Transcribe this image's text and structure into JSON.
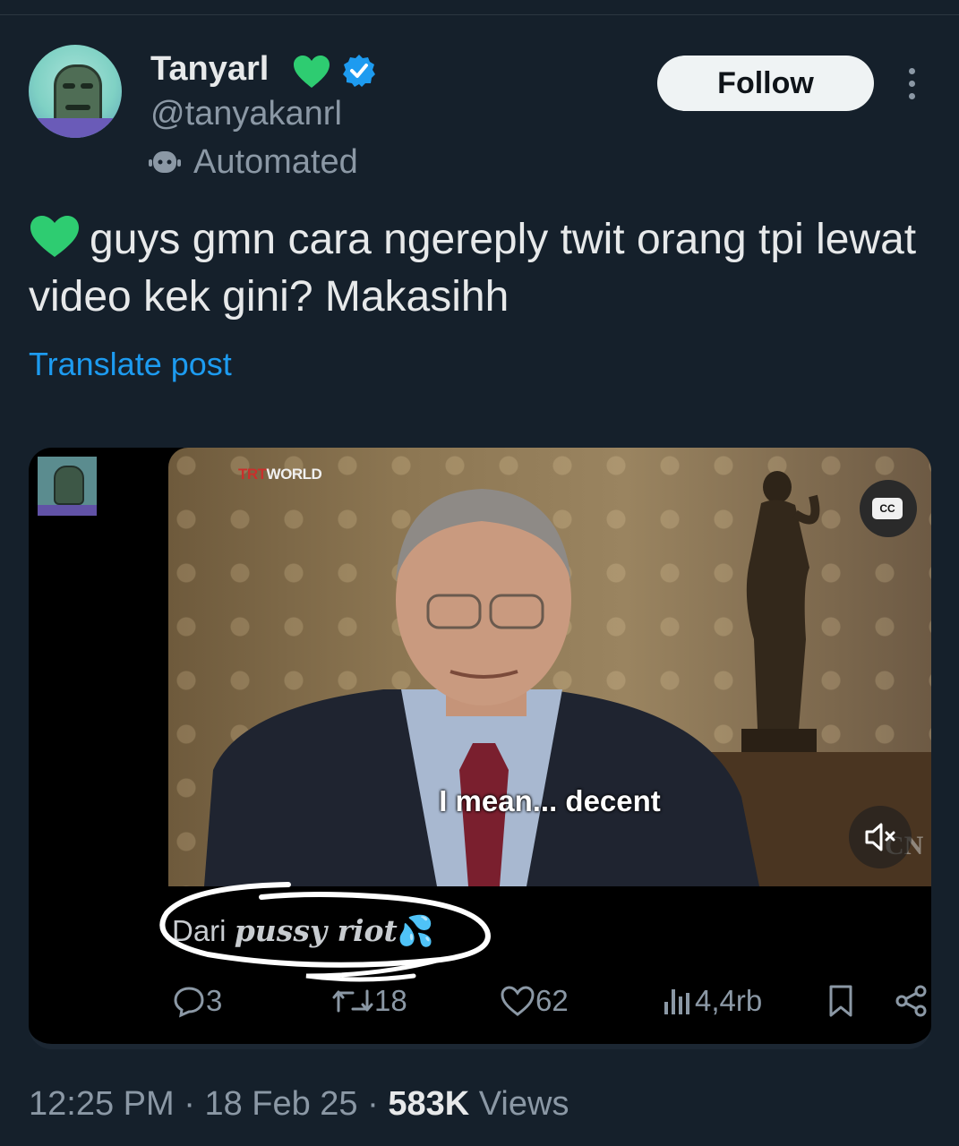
{
  "author": {
    "name": "Tanyarl",
    "handle": "@tanyakanrl",
    "label": "Automated"
  },
  "follow_label": "Follow",
  "post": {
    "text": "guys gmn cara ngereply twit orang tpi lewat video kek gini? Makasihh",
    "translate_label": "Translate post"
  },
  "media": {
    "channel_logo": "TRTWORLD",
    "channel_logo_red": "TRT",
    "channel_logo_white": "WORLD",
    "subtitle": "I mean... decent",
    "cc_label": "CC",
    "watermark": "CN",
    "caption_plain": "Dari",
    "caption_styled": "pussy riot",
    "caption_emoji": "💦"
  },
  "stats": {
    "replies": "3",
    "reposts": "18",
    "likes": "62",
    "views": "4,4rb"
  },
  "meta": {
    "time": "12:25 PM",
    "separator": "·",
    "date": "18 Feb 25",
    "views_count": "583K",
    "views_label": "Views"
  },
  "colors": {
    "background": "#15202b",
    "accent": "#1d9bf0",
    "heart_emoji": "#2ecc71",
    "verified": "#1d9bf0",
    "muted_text": "#8b98a5"
  },
  "icons": [
    "green-heart-icon",
    "verified-badge-icon",
    "robot-icon",
    "more-icon",
    "cc-icon",
    "mute-icon",
    "reply-icon",
    "repost-icon",
    "like-icon",
    "views-icon",
    "bookmark-icon",
    "share-icon"
  ]
}
